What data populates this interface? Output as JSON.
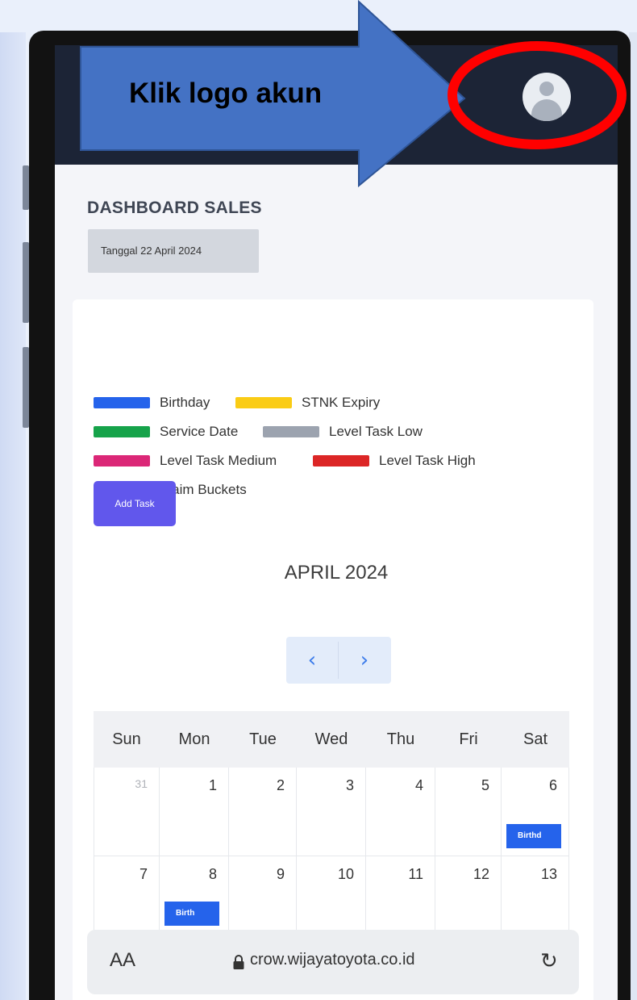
{
  "callout": {
    "text": "Klik logo akun",
    "arrow_color": "#4472c4",
    "highlight_color": "#ff0000"
  },
  "header": {
    "background": "#1c2436",
    "avatar_icon": "account-avatar-icon"
  },
  "dashboard": {
    "title": "DASHBOARD SALES",
    "date_label": "Tanggal 22 April 2024"
  },
  "legend": [
    {
      "label": "Birthday",
      "color": "#2563eb"
    },
    {
      "label": "STNK Expiry",
      "color": "#facc15"
    },
    {
      "label": "Service Date",
      "color": "#16a34a"
    },
    {
      "label": "Level Task Low",
      "color": "#9ca3af"
    },
    {
      "label": "Level Task Medium",
      "color": "#db2777"
    },
    {
      "label": "Level Task High",
      "color": "#dc2626"
    },
    {
      "label": "Klaim Buckets",
      "color": "#7e22ce"
    }
  ],
  "add_task_label": "Add Task",
  "calendar": {
    "month_title": "APRIL 2024",
    "prev_icon": "chevron-left-icon",
    "next_icon": "chevron-right-icon",
    "days_of_week": [
      "Sun",
      "Mon",
      "Tue",
      "Wed",
      "Thu",
      "Fri",
      "Sat"
    ],
    "weeks": [
      [
        {
          "day": "31",
          "muted": true,
          "event": ""
        },
        {
          "day": "1",
          "muted": false,
          "event": ""
        },
        {
          "day": "2",
          "muted": false,
          "event": ""
        },
        {
          "day": "3",
          "muted": false,
          "event": ""
        },
        {
          "day": "4",
          "muted": false,
          "event": ""
        },
        {
          "day": "5",
          "muted": false,
          "event": ""
        },
        {
          "day": "6",
          "muted": false,
          "event": "Birthd"
        }
      ],
      [
        {
          "day": "7",
          "muted": false,
          "event": ""
        },
        {
          "day": "8",
          "muted": false,
          "event": "Birth"
        },
        {
          "day": "9",
          "muted": false,
          "event": ""
        },
        {
          "day": "10",
          "muted": false,
          "event": ""
        },
        {
          "day": "11",
          "muted": false,
          "event": ""
        },
        {
          "day": "12",
          "muted": false,
          "event": ""
        },
        {
          "day": "13",
          "muted": false,
          "event": ""
        }
      ]
    ]
  },
  "browser": {
    "aa_label": "AA",
    "url": "crow.wijayatoyota.co.id",
    "lock_icon": "lock-icon",
    "reload_icon": "reload-icon"
  }
}
